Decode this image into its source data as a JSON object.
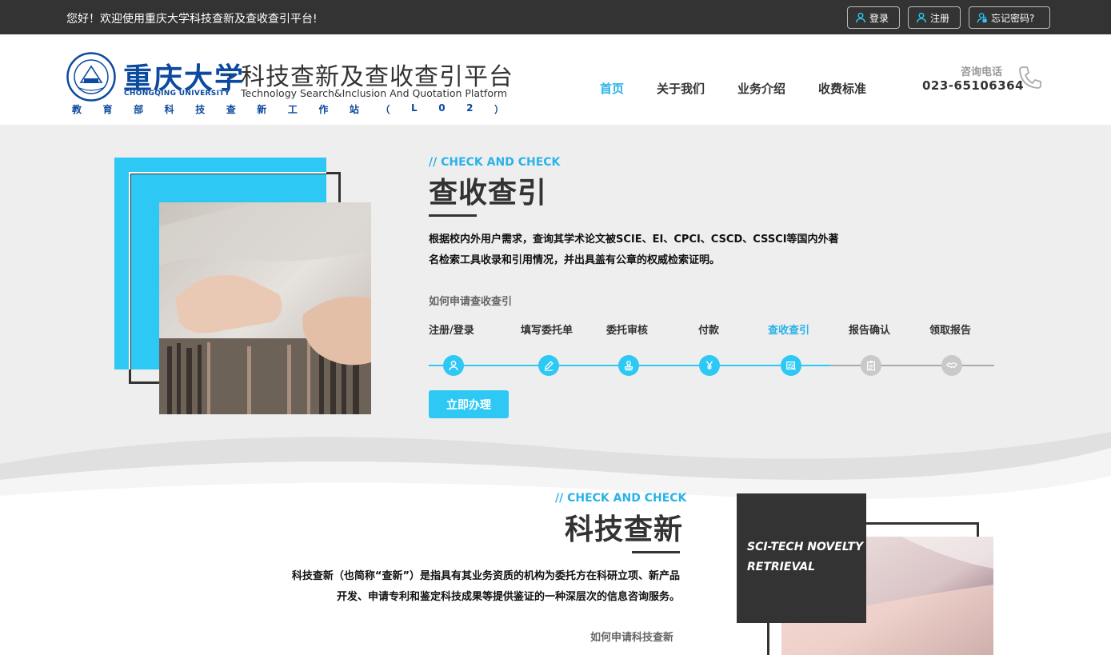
{
  "topbar": {
    "welcome": "您好！欢迎使用重庆大学科技查新及查收查引平台!",
    "login": "登录",
    "register": "注册",
    "forgot": "忘记密码?"
  },
  "header": {
    "university_name": "重庆大学",
    "university_en": "CHONGQING UNIVERSITY",
    "platform_title": "科技查新及查收查引平台",
    "platform_en": "Technology Search&Inclusion And Quotation Platform",
    "station_chars": [
      "教",
      "育",
      "部",
      "科",
      "技",
      "查",
      "新",
      "工",
      "作",
      "站",
      "（",
      "L",
      "0",
      "2",
      "）"
    ],
    "nav": [
      "首页",
      "关于我们",
      "业务介绍",
      "收费标准"
    ],
    "nav_active": "首页",
    "phone_label": "咨询电话",
    "phone_number": "023-65106364"
  },
  "section1": {
    "tag": "// CHECK AND CHECK",
    "title": "查收查引",
    "desc_line1": "根据校内外用户需求，查询其学术论文被SCIE、EI、CPCI、CSCD、CSSCI等国内外著",
    "desc_line2": "名检索工具收录和引用情况，并出具盖有公章的权威检索证明。",
    "how": "如何申请查收查引",
    "steps": [
      "注册/登录",
      "填写委托单",
      "委托审核",
      "付款",
      "查收查引",
      "报告确认",
      "领取报告"
    ],
    "active_step": "查收查引",
    "apply": "立即办理"
  },
  "section2": {
    "tag": "// CHECK AND CHECK",
    "title": "科技查新",
    "desc_line1": "科技查新（也简称“查新”）是指具有其业务资质的机构为委托方在科研立项、新产品",
    "desc_line2": "开发、申请专利和鉴定科技成果等提供鉴证的一种深层次的信息咨询服务。",
    "how": "如何申请科技查新",
    "card_line1": "SCI-TECH NOVELTY",
    "card_line2": "RETRIEVAL"
  },
  "colors": {
    "accent": "#2ec8f5",
    "dark": "#333333",
    "brand": "#0b4a9e"
  }
}
